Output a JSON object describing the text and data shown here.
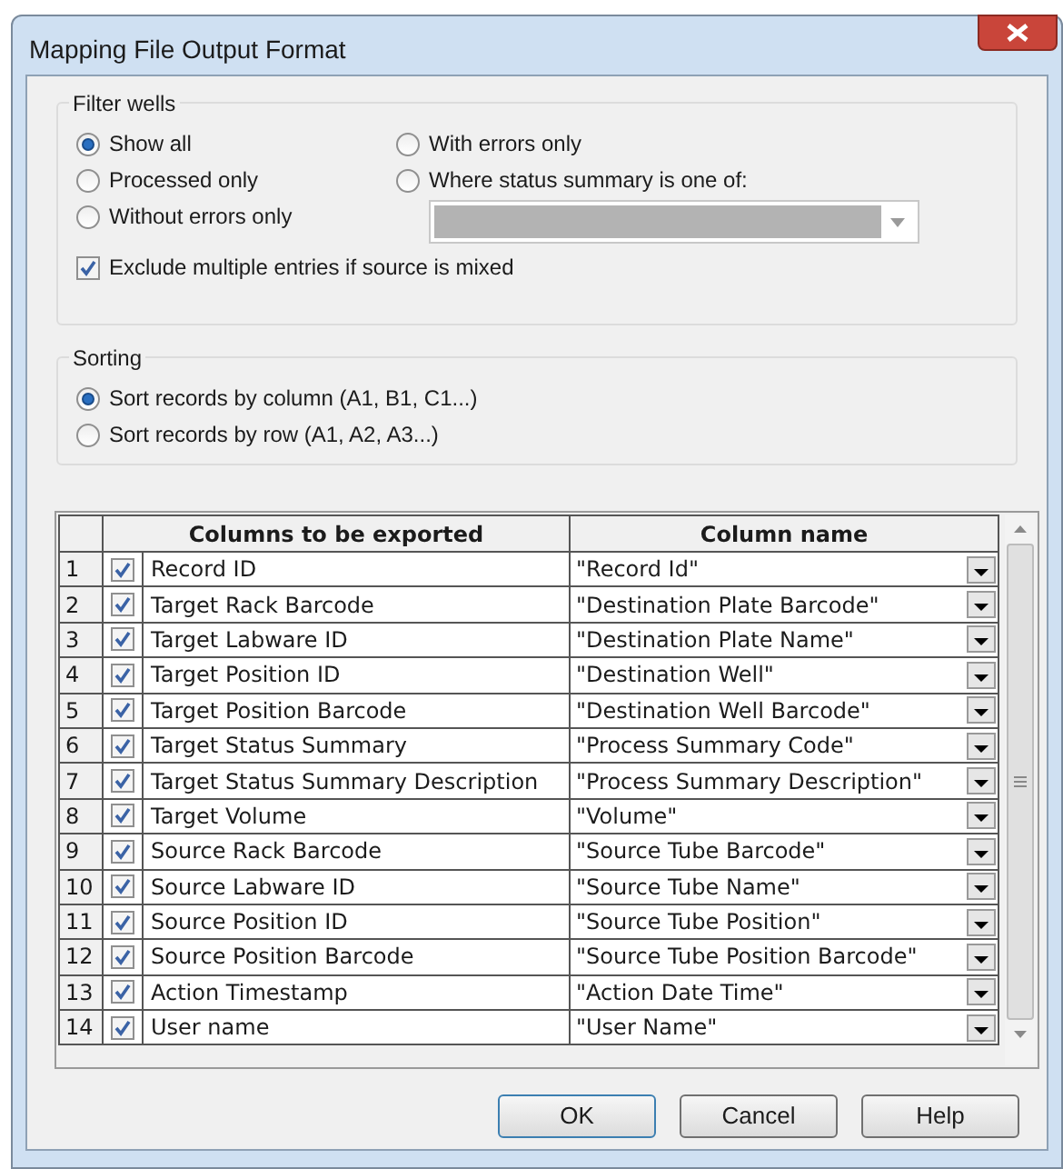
{
  "window": {
    "title": "Mapping File Output Format"
  },
  "filter_wells": {
    "title": "Filter wells",
    "options": [
      {
        "label": "Show all",
        "selected": true
      },
      {
        "label": "Processed only",
        "selected": false
      },
      {
        "label": "Without errors only",
        "selected": false
      },
      {
        "label": "With errors only",
        "selected": false
      },
      {
        "label": "Where status summary is one of:",
        "selected": false
      }
    ],
    "status_dropdown": {
      "disabled": true
    },
    "exclude_mixed": {
      "label": "Exclude multiple entries if source is mixed",
      "checked": true
    }
  },
  "sorting": {
    "title": "Sorting",
    "options": [
      {
        "label": "Sort records by column (A1, B1, C1...)",
        "selected": true
      },
      {
        "label": "Sort records by row (A1, A2, A3...)",
        "selected": false
      }
    ]
  },
  "table": {
    "columns": [
      "Columns to be exported",
      "Column name"
    ],
    "rows": [
      {
        "number": "1",
        "checked": true,
        "column": "Record ID",
        "name": "\"Record Id\""
      },
      {
        "number": "2",
        "checked": true,
        "column": "Target Rack Barcode",
        "name": "\"Destination Plate Barcode\""
      },
      {
        "number": "3",
        "checked": true,
        "column": "Target Labware ID",
        "name": "\"Destination Plate Name\""
      },
      {
        "number": "4",
        "checked": true,
        "column": "Target Position ID",
        "name": "\"Destination Well\""
      },
      {
        "number": "5",
        "checked": true,
        "column": "Target Position Barcode",
        "name": "\"Destination Well Barcode\""
      },
      {
        "number": "6",
        "checked": true,
        "column": "Target Status Summary",
        "name": "\"Process Summary Code\""
      },
      {
        "number": "7",
        "checked": true,
        "column": "Target Status Summary Description",
        "name": "\"Process Summary Description\""
      },
      {
        "number": "8",
        "checked": true,
        "column": "Target Volume",
        "name": "\"Volume\""
      },
      {
        "number": "9",
        "checked": true,
        "column": "Source Rack Barcode",
        "name": "\"Source Tube Barcode\""
      },
      {
        "number": "10",
        "checked": true,
        "column": "Source Labware ID",
        "name": "\"Source Tube Name\""
      },
      {
        "number": "11",
        "checked": true,
        "column": "Source Position ID",
        "name": "\"Source Tube Position\""
      },
      {
        "number": "12",
        "checked": true,
        "column": "Source Position Barcode",
        "name": "\"Source Tube Position Barcode\""
      },
      {
        "number": "13",
        "checked": true,
        "column": "Action Timestamp",
        "name": "\"Action Date Time\""
      },
      {
        "number": "14",
        "checked": true,
        "column": "User name",
        "name": "\"User Name\""
      }
    ]
  },
  "buttons": [
    "OK",
    "Cancel",
    "Help"
  ]
}
